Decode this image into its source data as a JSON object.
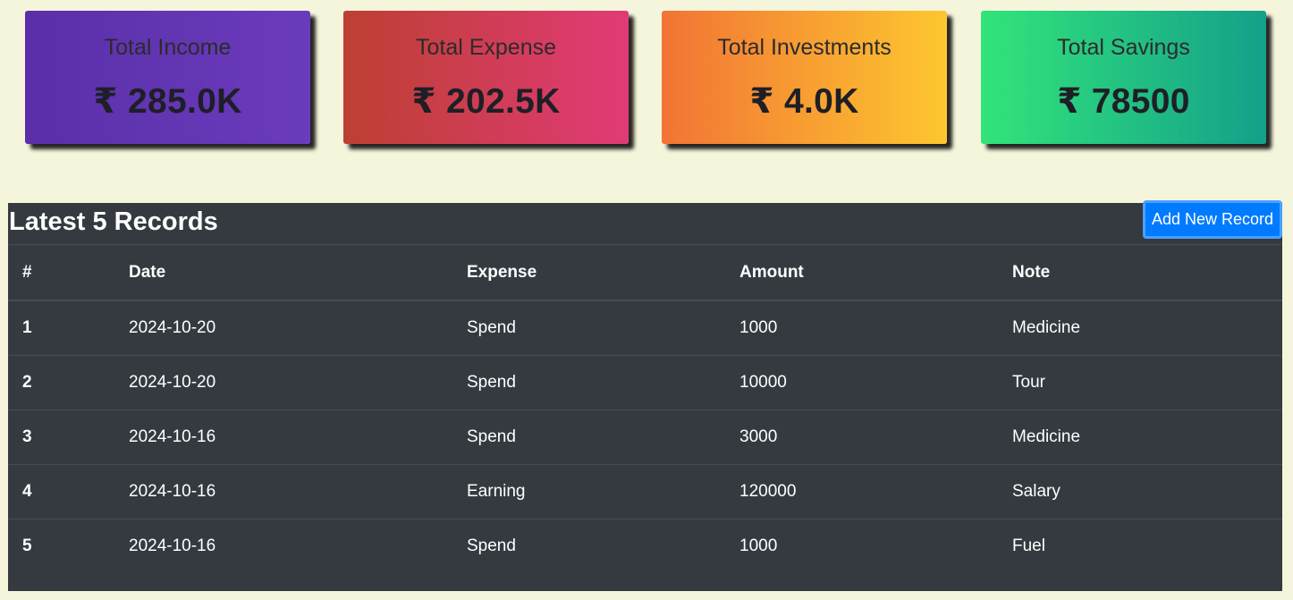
{
  "summary_cards": [
    {
      "title": "Total Income",
      "value": "₹ 285.0K"
    },
    {
      "title": "Total Expense",
      "value": "₹ 202.5K"
    },
    {
      "title": "Total Investments",
      "value": "₹ 4.0K"
    },
    {
      "title": "Total Savings",
      "value": "₹ 78500"
    }
  ],
  "records": {
    "title": "Latest 5 Records",
    "add_button_label": "Add New Record",
    "columns": [
      "#",
      "Date",
      "Expense",
      "Amount",
      "Note"
    ],
    "rows": [
      {
        "num": "1",
        "date": "2024-10-20",
        "expense": "Spend",
        "amount": "1000",
        "note": "Medicine"
      },
      {
        "num": "2",
        "date": "2024-10-20",
        "expense": "Spend",
        "amount": "10000",
        "note": "Tour"
      },
      {
        "num": "3",
        "date": "2024-10-16",
        "expense": "Spend",
        "amount": "3000",
        "note": "Medicine"
      },
      {
        "num": "4",
        "date": "2024-10-16",
        "expense": "Earning",
        "amount": "120000",
        "note": "Salary"
      },
      {
        "num": "5",
        "date": "2024-10-16",
        "expense": "Spend",
        "amount": "1000",
        "note": "Fuel"
      }
    ]
  },
  "colors": {
    "page_background": "#f5f5dc",
    "table_background": "#343a40",
    "button_primary": "#007bff",
    "income_gradient": [
      "#5a2fa8",
      "#6b3bbd"
    ],
    "expense_gradient": [
      "#bd3f32",
      "#e13b76"
    ],
    "investments_gradient": [
      "#f27435",
      "#fdc72f"
    ],
    "savings_gradient": [
      "#32e47a",
      "#14a08a"
    ]
  }
}
